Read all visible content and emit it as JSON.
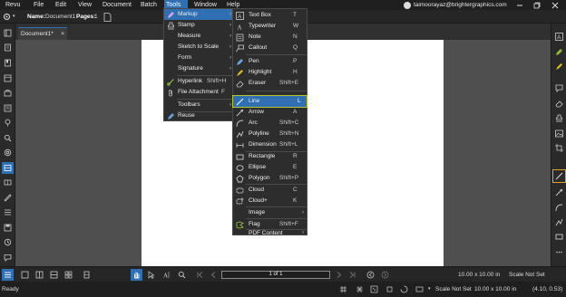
{
  "menubar": {
    "items": [
      "Revu",
      "File",
      "Edit",
      "View",
      "Document",
      "Batch",
      "Tools",
      "Window",
      "Help"
    ],
    "user_email": "taimoorayaz@brightergraphics.com"
  },
  "props": {
    "name_label": "Name:",
    "name_value": "Document1",
    "pages_label": "Pages:",
    "pages_value": "1"
  },
  "tab": {
    "label": "Document1*",
    "close": "×"
  },
  "tools_menu": {
    "items": [
      {
        "label": "Markup",
        "shortcut": "",
        "arrow": "›",
        "icon": "markup-icon"
      },
      {
        "label": "Stamp",
        "shortcut": "",
        "arrow": "›",
        "icon": "stamp-icon"
      },
      {
        "label": "Measure",
        "shortcut": "",
        "arrow": "›",
        "icon": ""
      },
      {
        "label": "Sketch to Scale",
        "shortcut": "",
        "arrow": "›",
        "icon": ""
      },
      {
        "label": "Form",
        "shortcut": "",
        "arrow": "›",
        "icon": ""
      },
      {
        "label": "Signature",
        "shortcut": "",
        "arrow": "›",
        "icon": ""
      },
      {
        "label": "Hyperlink",
        "shortcut": "Shift+H",
        "arrow": "",
        "icon": "hyperlink-icon"
      },
      {
        "label": "File Attachment",
        "shortcut": "F",
        "arrow": "",
        "icon": "attachment-icon"
      },
      {
        "label": "Toolbars",
        "shortcut": "",
        "arrow": "›",
        "icon": ""
      },
      {
        "label": "Reuse",
        "shortcut": "",
        "arrow": "",
        "icon": "reuse-icon"
      }
    ]
  },
  "markup_menu": {
    "items": [
      {
        "label": "Text Box",
        "shortcut": "T",
        "arrow": ""
      },
      {
        "label": "Typewriter",
        "shortcut": "W",
        "arrow": ""
      },
      {
        "label": "Note",
        "shortcut": "N",
        "arrow": ""
      },
      {
        "label": "Callout",
        "shortcut": "Q",
        "arrow": ""
      },
      {
        "label": "Pen",
        "shortcut": "P",
        "arrow": ""
      },
      {
        "label": "Highlight",
        "shortcut": "H",
        "arrow": ""
      },
      {
        "label": "Eraser",
        "shortcut": "Shift+E",
        "arrow": ""
      },
      {
        "label": "Line",
        "shortcut": "L",
        "arrow": "",
        "highlighted": true
      },
      {
        "label": "Arrow",
        "shortcut": "A",
        "arrow": ""
      },
      {
        "label": "Arc",
        "shortcut": "Shift+C",
        "arrow": ""
      },
      {
        "label": "Polyline",
        "shortcut": "Shift+N",
        "arrow": ""
      },
      {
        "label": "Dimension",
        "shortcut": "Shift+L",
        "arrow": ""
      },
      {
        "label": "Rectangle",
        "shortcut": "R",
        "arrow": ""
      },
      {
        "label": "Ellipse",
        "shortcut": "E",
        "arrow": ""
      },
      {
        "label": "Polygon",
        "shortcut": "Shift+P",
        "arrow": ""
      },
      {
        "label": "Cloud",
        "shortcut": "C",
        "arrow": ""
      },
      {
        "label": "Cloud+",
        "shortcut": "K",
        "arrow": ""
      },
      {
        "label": "Image",
        "shortcut": "",
        "arrow": "›"
      },
      {
        "label": "Flag",
        "shortcut": "Shift+F",
        "arrow": ""
      },
      {
        "label": "PDF Content",
        "shortcut": "",
        "arrow": "›"
      }
    ]
  },
  "bottom": {
    "page_indicator": "1 of 1",
    "page_size": "10.00 x 10.00 in",
    "scale": "Scale Not Set"
  },
  "status": {
    "ready": "Ready",
    "scale": "Scale Not Set",
    "size": "10.00 x 10.00 in",
    "coords": "(4.10, 0.53)"
  },
  "colors": {
    "accent": "#2f6fb2",
    "selected_outline": "#e0a22a",
    "highlight_outline": "#b3c832"
  }
}
